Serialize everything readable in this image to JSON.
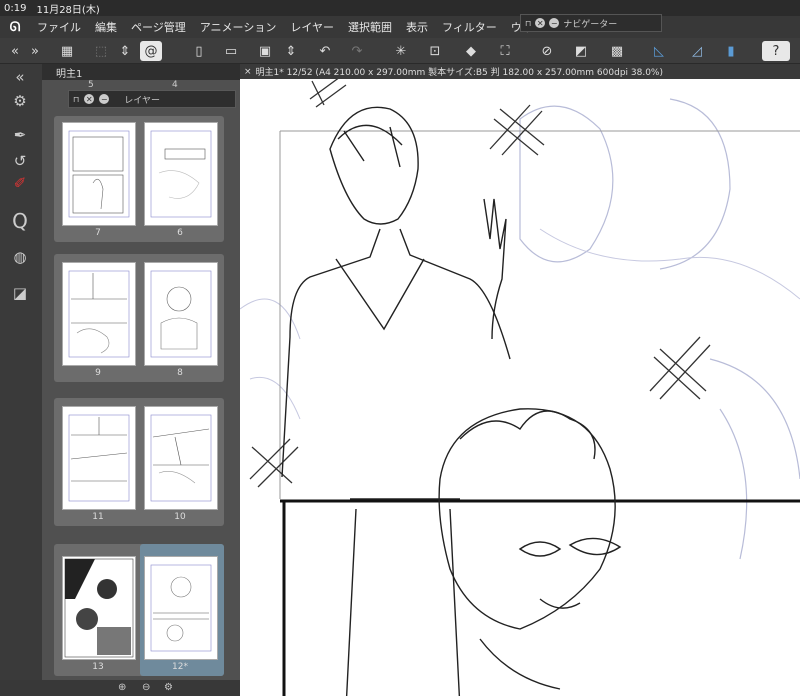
{
  "status": {
    "time": "0:19",
    "date": "11月28日(木)"
  },
  "menu": {
    "items": [
      "ファイル",
      "編集",
      "ページ管理",
      "アニメーション",
      "レイヤー",
      "選択範囲",
      "表示",
      "フィルター",
      "ウィン"
    ]
  },
  "navigator": {
    "title": "ナビゲーター"
  },
  "panel": {
    "tab_label": "明主1",
    "top_numbers": [
      "5",
      "4"
    ],
    "layer_window_title": "レイヤー",
    "pages": [
      {
        "left": "7",
        "right": "6"
      },
      {
        "left": "9",
        "right": "8"
      },
      {
        "left": "11",
        "right": "10"
      },
      {
        "left": "13",
        "right": "12*"
      }
    ]
  },
  "canvas": {
    "doc_tab": "明主1* 12/52 (A4 210.00 x 297.00mm 製本サイズ:B5 判 182.00 x 257.00mm 600dpi 38.0%)"
  },
  "colors": {
    "accent": "#5b9bd5",
    "selected_page": "#6f8a9c"
  }
}
